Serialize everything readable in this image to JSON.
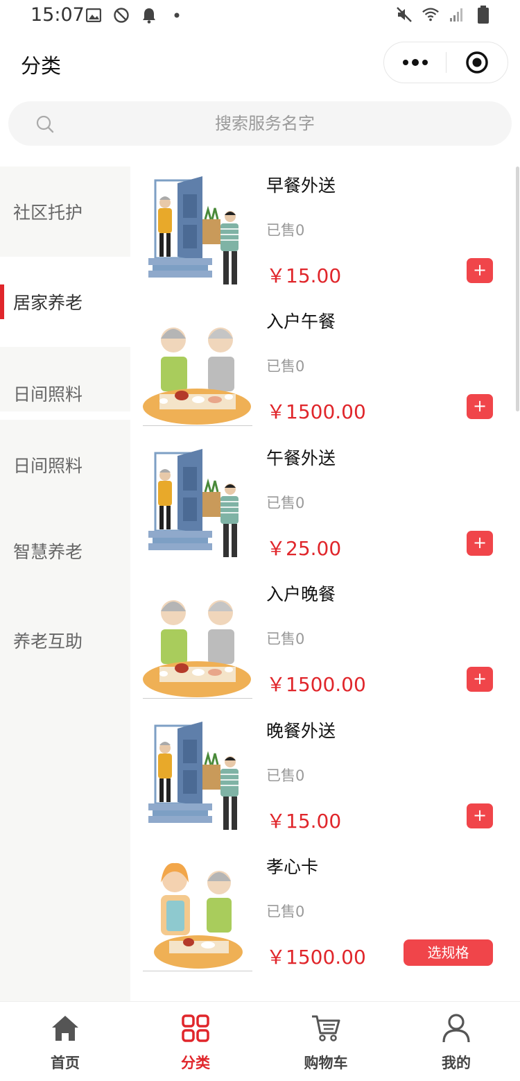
{
  "status_bar": {
    "time": "15:07"
  },
  "header": {
    "title": "分类"
  },
  "search": {
    "placeholder": "搜索服务名字"
  },
  "sidebar": {
    "items": [
      {
        "label": "社区托护"
      },
      {
        "label": "居家养老",
        "active": true
      },
      {
        "label": "日间照料"
      },
      {
        "label": "日间照料"
      },
      {
        "label": "智慧养老"
      },
      {
        "label": "养老互助"
      }
    ]
  },
  "products": [
    {
      "name": "早餐外送",
      "sold": "已售0",
      "price": "￥15.00",
      "action": "+"
    },
    {
      "name": "入户午餐",
      "sold": "已售0",
      "price": "￥1500.00",
      "action": "+"
    },
    {
      "name": "午餐外送",
      "sold": "已售0",
      "price": "￥25.00",
      "action": "+"
    },
    {
      "name": "入户晚餐",
      "sold": "已售0",
      "price": "￥1500.00",
      "action": "+"
    },
    {
      "name": "晚餐外送",
      "sold": "已售0",
      "price": "￥15.00",
      "action": "+"
    },
    {
      "name": "孝心卡",
      "sold": "已售0",
      "price": "￥1500.00",
      "action": "选规格"
    }
  ],
  "tabbar": {
    "items": [
      {
        "label": "首页",
        "icon": "home-icon"
      },
      {
        "label": "分类",
        "icon": "grid-icon",
        "active": true
      },
      {
        "label": "购物车",
        "icon": "cart-icon"
      },
      {
        "label": "我的",
        "icon": "user-icon"
      }
    ]
  },
  "colors": {
    "accent": "#e0262b",
    "button": "#f0454a",
    "sidebar_bg": "#f7f7f5"
  }
}
